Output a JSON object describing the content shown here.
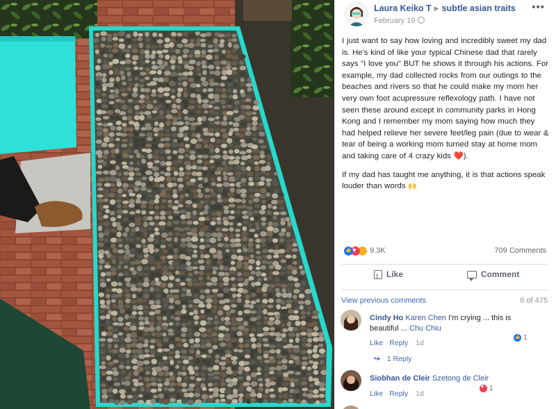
{
  "post": {
    "author": "Laura Keiko T",
    "group": "subtle asian traits",
    "date": "February 19",
    "more_icon": "ellipsis-icon",
    "paragraphs": [
      "I just want to say how loving and incredibly sweet my dad is. He's kind of like your typical Chinese dad that rarely says \"I love you\" BUT he shows it through his actions. For example, my dad collected rocks from our outings to the beaches and rivers so that he could make my mom her very own foot acupressure reflexology path. I have not seen these around except in community parks in Hong Kong and I remember my mom saying how much they had helped relieve her severe feet/leg pain (due to wear & tear of being a working mom turned stay at home mom and taking care of 4 crazy kids",
      "If my dad has taught me anything, it is that actions speak louder than words"
    ],
    "p1_suffix": ").",
    "p1_emoji": "❤️",
    "p2_emoji": "🙌"
  },
  "stats": {
    "reaction_count": "9.3K",
    "comment_count": "709 Comments"
  },
  "actions": {
    "like_label": "Like",
    "comment_label": "Comment"
  },
  "comments_section": {
    "view_previous": "View previous comments",
    "range": "6 of 475",
    "comments": [
      {
        "author": "Cindy Ho",
        "mention": "Karen Chen",
        "text_a": " I'm crying ... this is beautiful ... ",
        "mention2": "Chu Chiu",
        "like_label": "Like",
        "reply_label": "Reply",
        "time": "1d",
        "reaction_count": "1"
      },
      {
        "author": "Siobhan de Cleir",
        "mention": "Szetong de Cleir",
        "like_label": "Like",
        "reply_label": "Reply",
        "time": "1d",
        "reaction_count": "1"
      }
    ],
    "replies_label": "1 Reply"
  },
  "colors": {
    "link_blue": "#365899",
    "accent_blue": "#4267b2",
    "teal_paint": "#2fe0d8",
    "heart_red": "#e0202e"
  }
}
